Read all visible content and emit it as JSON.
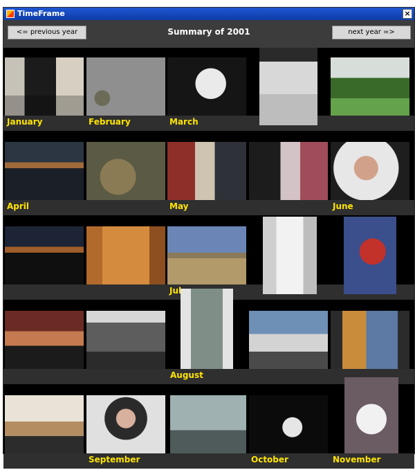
{
  "window": {
    "title": "TimeFrame",
    "close_label": "×"
  },
  "toolbar": {
    "prev_label": "<= previous year",
    "next_label": "next year =>",
    "summary": "Summary of 2001"
  },
  "months": [
    "January",
    "February",
    "March",
    "April",
    "May",
    "June",
    "July",
    "August",
    "September",
    "October",
    "November"
  ]
}
